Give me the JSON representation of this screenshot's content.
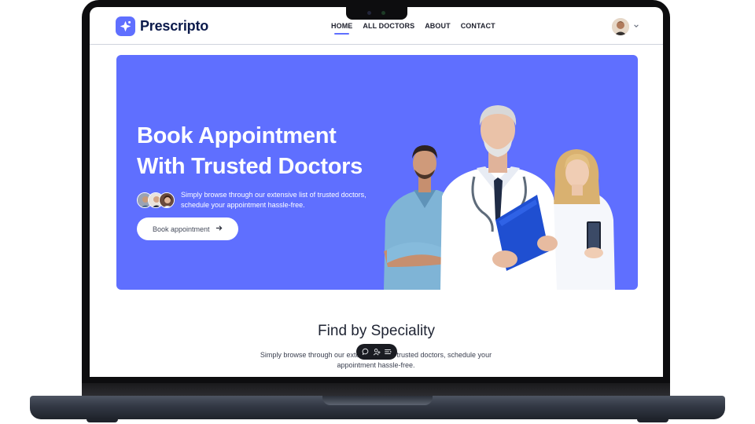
{
  "brand": {
    "name": "Prescripto",
    "accent": "#5f6fff"
  },
  "nav": {
    "links": [
      {
        "label": "HOME",
        "active": true
      },
      {
        "label": "ALL DOCTORS",
        "active": false
      },
      {
        "label": "ABOUT",
        "active": false
      },
      {
        "label": "CONTACT",
        "active": false
      }
    ],
    "profile_icon": "user-avatar",
    "dropdown_icon": "chevron-down-icon"
  },
  "hero": {
    "title_line1": "Book Appointment",
    "title_line2": "With Trusted Doctors",
    "subtitle_line1": "Simply browse through our extensive list of trusted doctors,",
    "subtitle_line2": "schedule your appointment hassle-free.",
    "cta_label": "Book appointment",
    "cta_icon": "arrow-right-icon",
    "background": "#5f6fff"
  },
  "speciality": {
    "title": "Find by Speciality",
    "subtitle_line1": "Simply browse through our extensive list of trusted doctors, schedule your",
    "subtitle_line2": "appointment hassle-free."
  },
  "floating_toolbar": {
    "icons": [
      "comment-icon",
      "user-add-icon",
      "menu-list-icon"
    ]
  }
}
